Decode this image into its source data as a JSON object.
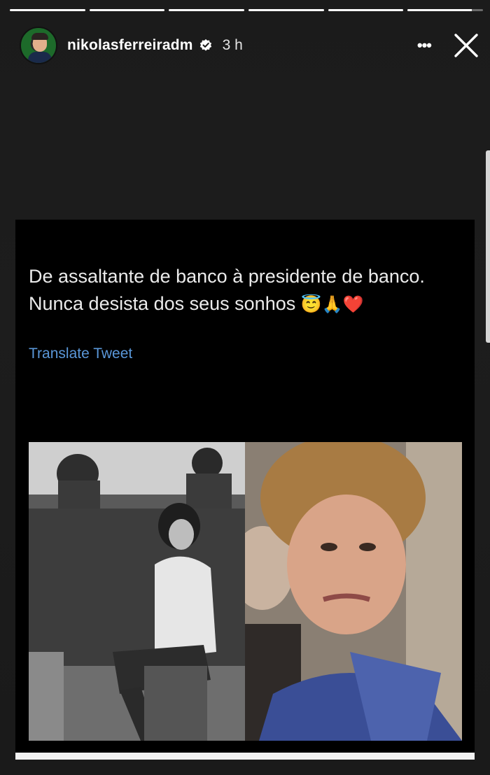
{
  "story": {
    "username": "nikolasferreiradm",
    "time_ago": "3 h",
    "verified": true,
    "progress_segments": [
      1,
      1,
      1,
      1,
      1,
      0.85
    ],
    "icons": {
      "more": "more-horizontal-icon",
      "close": "close-icon",
      "verified": "verified-badge-icon"
    },
    "more_label": "•••"
  },
  "post": {
    "tweet_line1": "De assaltante de banco à presidente de banco.",
    "tweet_line2": "Nunca desista dos seus sonhos",
    "tweet_emojis": "😇🙏❤️",
    "translate_label": "Translate Tweet"
  },
  "colors": {
    "link": "#5a97d9",
    "background": "#1c1c1c"
  }
}
